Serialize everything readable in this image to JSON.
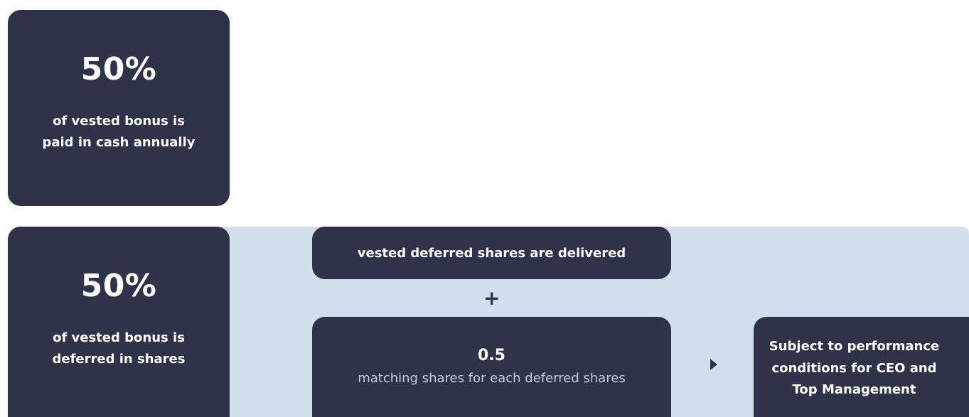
{
  "cash_card": {
    "percent": "50%",
    "line1": "of vested bonus is",
    "line2": "paid in cash annually"
  },
  "shares_card": {
    "percent": "50%",
    "line1": "of vested bonus is",
    "line2": "deferred in shares"
  },
  "delivered_card": {
    "text": "vested deferred shares are delivered"
  },
  "plus_symbol": "+",
  "matching_card": {
    "ratio": "0.5",
    "description": "matching shares for each deferred shares"
  },
  "arrow_icon": "triangle-right-icon",
  "conditions_card": {
    "line1": "Subject to performance",
    "line2": "conditions for CEO and",
    "line3": "Top Management"
  },
  "colors": {
    "card_bg": "#2d3348",
    "band_bg": "#d2deec",
    "text_light": "#ffffff"
  }
}
